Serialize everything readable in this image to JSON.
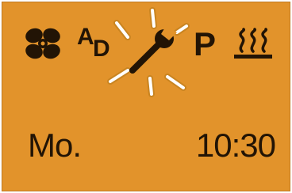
{
  "display": {
    "background_color": "#e2932b",
    "text_color": "#221405",
    "highlight_color": "#ffffff"
  },
  "status_icons": {
    "fan": "fan-icon",
    "auto_defrost": {
      "a": "A",
      "d": "D"
    },
    "service": "wrench-icon",
    "service_state": "blinking",
    "parking": "P",
    "heating": "heating-icon"
  },
  "clock": {
    "day": "Mo.",
    "time": "10:30"
  }
}
